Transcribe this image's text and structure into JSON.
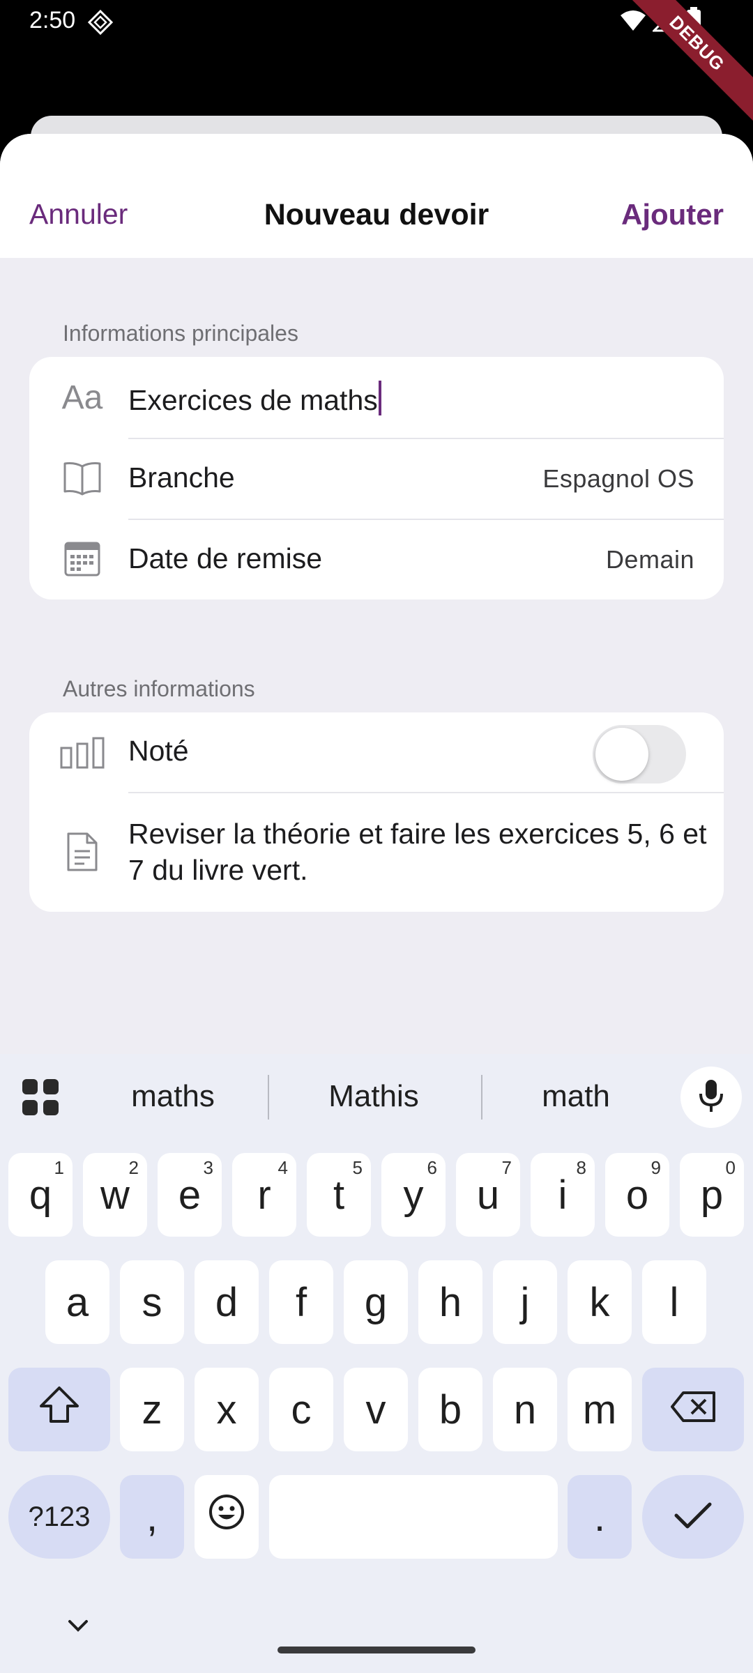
{
  "status_bar": {
    "time": "2:50",
    "debug_banner": "DEBUG"
  },
  "nav": {
    "cancel": "Annuler",
    "title": "Nouveau devoir",
    "add": "Ajouter"
  },
  "main_info": {
    "section_label": "Informations principales",
    "title_icon_text": "Aa",
    "title_value": "Exercices de maths",
    "subject_label": "Branche",
    "subject_value": "Espagnol OS",
    "due_label": "Date de remise",
    "due_value": "Demain"
  },
  "other_info": {
    "section_label": "Autres informations",
    "graded_label": "Noté",
    "graded_on": false,
    "description": "Reviser la théorie et faire les exercices 5, 6 et 7 du livre vert."
  },
  "keyboard": {
    "suggestions": [
      "maths",
      "Mathis",
      "math"
    ],
    "row1": [
      "q",
      "w",
      "e",
      "r",
      "t",
      "y",
      "u",
      "i",
      "o",
      "p"
    ],
    "row1_hints": [
      "1",
      "2",
      "3",
      "4",
      "5",
      "6",
      "7",
      "8",
      "9",
      "0"
    ],
    "row2": [
      "a",
      "s",
      "d",
      "f",
      "g",
      "h",
      "j",
      "k",
      "l"
    ],
    "row3": [
      "z",
      "x",
      "c",
      "v",
      "b",
      "n",
      "m"
    ],
    "symbols_key": "?123",
    "comma_key": ",",
    "period_key": "."
  }
}
